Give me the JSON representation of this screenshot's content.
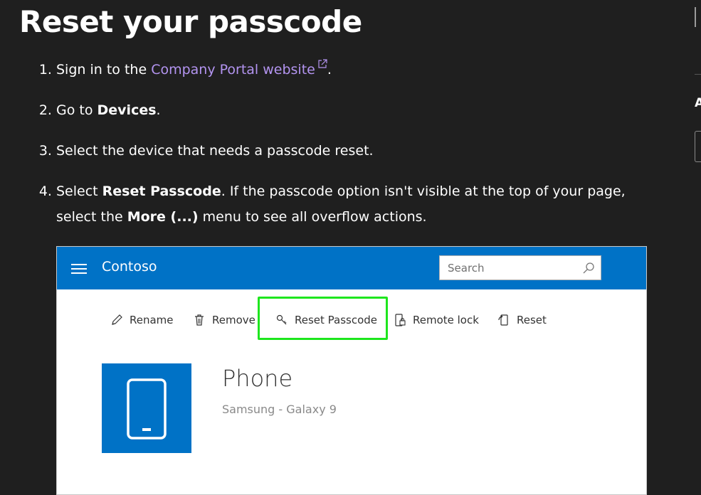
{
  "title": "Reset your passcode",
  "steps": [
    {
      "number": "1",
      "pre": "Sign in to the ",
      "link": "Company Portal website",
      "post": "."
    },
    {
      "number": "2",
      "pre": "Go to ",
      "bold": "Devices",
      "post": "."
    },
    {
      "number": "3",
      "text": "Select the device that needs a passcode reset."
    },
    {
      "number": "4",
      "pre": "Select ",
      "bold1": "Reset Passcode",
      "mid": ". If the passcode option isn't visible at the top of your page, select the ",
      "bold2": "More (...)",
      "post": " menu to see all overflow actions."
    }
  ],
  "sidebar": {
    "letter": "A"
  },
  "screenshot": {
    "brand": "Contoso",
    "search_placeholder": "Search",
    "toolbar": {
      "rename": "Rename",
      "remove": "Remove",
      "reset_passcode": "Reset Passcode",
      "remote_lock": "Remote lock",
      "reset": "Reset"
    },
    "device": {
      "name": "Phone",
      "model": "Samsung - Galaxy 9"
    }
  },
  "colors": {
    "background": "#1f1f1f",
    "link": "#b394f0",
    "header_blue": "#0072c6",
    "highlight_green": "#1ee61e"
  }
}
